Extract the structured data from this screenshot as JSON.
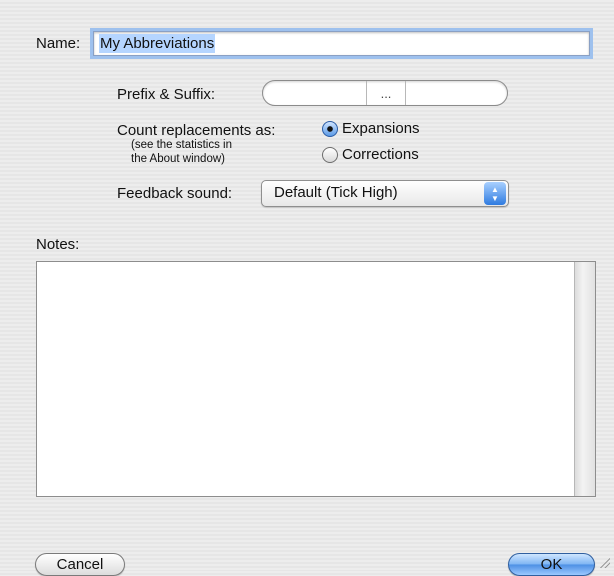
{
  "form": {
    "name_label": "Name:",
    "name_value": "My Abbreviations",
    "prefix_suffix_label": "Prefix & Suffix:",
    "prefix_value": "",
    "ellipsis": "...",
    "suffix_value": "",
    "count_label": "Count replacements as:",
    "count_note_line1": "(see the statistics in",
    "count_note_line2": "the About window)",
    "count_options": [
      {
        "label": "Expansions",
        "selected": true
      },
      {
        "label": "Corrections",
        "selected": false
      }
    ],
    "feedback_label": "Feedback sound:",
    "feedback_value": "Default (Tick High)",
    "notes_label": "Notes:",
    "notes_value": ""
  },
  "buttons": {
    "cancel": "Cancel",
    "ok": "OK"
  },
  "colors": {
    "default_button": "#4c8fe4",
    "focus_ring": "#9ec1ee",
    "text_selection": "#b5d5ff"
  }
}
